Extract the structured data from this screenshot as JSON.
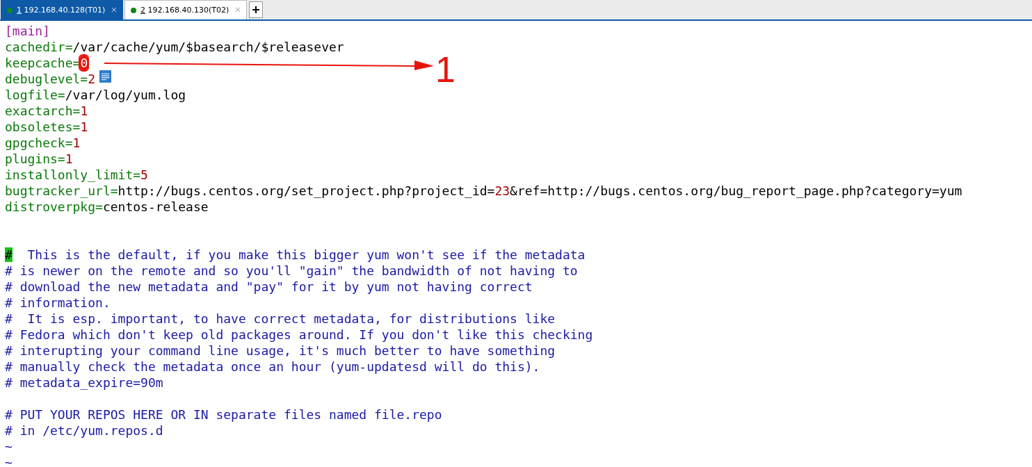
{
  "tabs": [
    {
      "number": "1",
      "label": "192.168.40.128(T01)",
      "selected": true
    },
    {
      "number": "2",
      "label": "192.168.40.130(T02)",
      "selected": false
    }
  ],
  "lines": [
    {
      "kind": "code",
      "segments": [
        {
          "kind": "section",
          "text": "[main]"
        }
      ]
    },
    {
      "kind": "code",
      "segments": [
        {
          "kind": "key",
          "text": "cachedir="
        },
        {
          "kind": "value",
          "text": "/var/cache/yum/$basearch/$releasever"
        }
      ]
    },
    {
      "kind": "code",
      "segments": [
        {
          "kind": "key",
          "text": "keepcache="
        },
        {
          "kind": "marked",
          "text": "0"
        }
      ]
    },
    {
      "kind": "code",
      "segments": [
        {
          "kind": "key",
          "text": "debuglevel="
        },
        {
          "kind": "number",
          "text": "2"
        }
      ]
    },
    {
      "kind": "code",
      "segments": [
        {
          "kind": "key",
          "text": "logfile="
        },
        {
          "kind": "value",
          "text": "/var/log/yum.log"
        }
      ]
    },
    {
      "kind": "code",
      "segments": [
        {
          "kind": "key",
          "text": "exactarch="
        },
        {
          "kind": "number",
          "text": "1"
        }
      ]
    },
    {
      "kind": "code",
      "segments": [
        {
          "kind": "key",
          "text": "obsoletes="
        },
        {
          "kind": "number",
          "text": "1"
        }
      ]
    },
    {
      "kind": "code",
      "segments": [
        {
          "kind": "key",
          "text": "gpgcheck="
        },
        {
          "kind": "number",
          "text": "1"
        }
      ]
    },
    {
      "kind": "code",
      "segments": [
        {
          "kind": "key",
          "text": "plugins="
        },
        {
          "kind": "number",
          "text": "1"
        }
      ]
    },
    {
      "kind": "code",
      "segments": [
        {
          "kind": "key",
          "text": "installonly_limit="
        },
        {
          "kind": "number",
          "text": "5"
        }
      ]
    },
    {
      "kind": "code",
      "segments": [
        {
          "kind": "key",
          "text": "bugtracker_url="
        },
        {
          "kind": "value",
          "text": "http://bugs.centos.org/set_project.php?project_id="
        },
        {
          "kind": "number",
          "text": "23"
        },
        {
          "kind": "value",
          "text": "&ref=http://bugs.centos.org/bug_report_page.php?category=yum"
        }
      ]
    },
    {
      "kind": "code",
      "segments": [
        {
          "kind": "key",
          "text": "distroverpkg="
        },
        {
          "kind": "value",
          "text": "centos-release"
        }
      ]
    },
    {
      "kind": "blank"
    },
    {
      "kind": "blank"
    },
    {
      "kind": "code",
      "segments": [
        {
          "kind": "cursor",
          "text": "#"
        },
        {
          "kind": "comment",
          "text": "  This is the default, if you make this bigger yum won't see if the metadata"
        }
      ]
    },
    {
      "kind": "code",
      "segments": [
        {
          "kind": "comment",
          "text": "# is newer on the remote and so you'll \"gain\" the bandwidth of not having to"
        }
      ]
    },
    {
      "kind": "code",
      "segments": [
        {
          "kind": "comment",
          "text": "# download the new metadata and \"pay\" for it by yum not having correct"
        }
      ]
    },
    {
      "kind": "code",
      "segments": [
        {
          "kind": "comment",
          "text": "# information."
        }
      ]
    },
    {
      "kind": "code",
      "segments": [
        {
          "kind": "comment",
          "text": "#  It is esp. important, to have correct metadata, for distributions like"
        }
      ]
    },
    {
      "kind": "code",
      "segments": [
        {
          "kind": "comment",
          "text": "# Fedora which don't keep old packages around. If you don't like this checking"
        }
      ]
    },
    {
      "kind": "code",
      "segments": [
        {
          "kind": "comment",
          "text": "# interupting your command line usage, it's much better to have something"
        }
      ]
    },
    {
      "kind": "code",
      "segments": [
        {
          "kind": "comment",
          "text": "# manually check the metadata once an hour (yum-updatesd will do this)."
        }
      ]
    },
    {
      "kind": "code",
      "segments": [
        {
          "kind": "comment",
          "text": "# metadata_expire=90m"
        }
      ]
    },
    {
      "kind": "blank"
    },
    {
      "kind": "code",
      "segments": [
        {
          "kind": "comment",
          "text": "# PUT YOUR REPOS HERE OR IN separate files named file.repo"
        }
      ]
    },
    {
      "kind": "code",
      "segments": [
        {
          "kind": "comment",
          "text": "# in /etc/yum.repos.d"
        }
      ]
    },
    {
      "kind": "code",
      "segments": [
        {
          "kind": "tilde",
          "text": "~"
        }
      ]
    },
    {
      "kind": "code",
      "segments": [
        {
          "kind": "tilde",
          "text": "~"
        }
      ]
    }
  ],
  "annotation": {
    "label": "1"
  }
}
